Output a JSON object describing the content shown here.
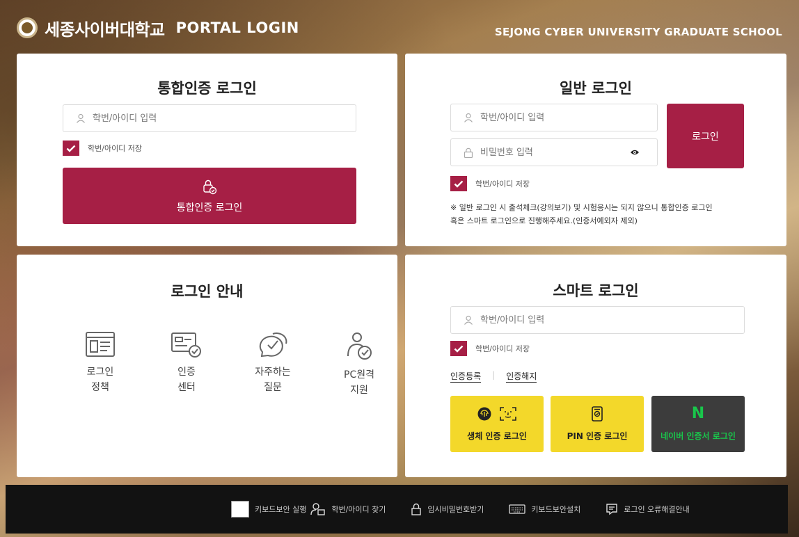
{
  "header": {
    "brand_name": "세종사이버대학교",
    "brand_sub": "PORTAL LOGIN",
    "graduate": "SEJONG CYBER UNIVERSITY GRADUATE SCHOOL"
  },
  "integrated": {
    "title": "통합인증 로그인",
    "id_placeholder": "학번/아이디 입력",
    "save_id_label": "학번/아이디 저장",
    "login_button": "통합인증 로그인"
  },
  "general": {
    "title": "일반 로그인",
    "id_placeholder": "학번/아이디 입력",
    "pw_placeholder": "비밀번호 입력",
    "login_button": "로그인",
    "save_id_label": "학번/아이디 저장",
    "notice_line1": "※ 일반 로그인 시 출석체크(강의보기) 및 시험응시는 되지 않으니 통합인증 로그인",
    "notice_line2": "혹은 스마트 로그인으로 진행해주세요.(인증서예외자 제외)"
  },
  "guide": {
    "title": "로그인 안내",
    "items": [
      {
        "line1": "로그인",
        "line2": "정책",
        "icon": "policy-document-icon"
      },
      {
        "line1": "인증",
        "line2": "센터",
        "icon": "certificate-card-icon"
      },
      {
        "line1": "자주하는",
        "line2": "질문",
        "icon": "faq-chat-icon"
      },
      {
        "line1": "PC원격",
        "line2": "지원",
        "icon": "remote-support-user-icon"
      }
    ]
  },
  "smart": {
    "title": "스마트 로그인",
    "id_placeholder": "학번/아이디 입력",
    "save_id_label": "학번/아이디 저장",
    "cert_register": "인증등록",
    "cert_cancel": "인증해지",
    "bio_login": "생체 인증 로그인",
    "pin_login": "PIN 인증 로그인",
    "naver_login": "네이버 인증서 로그인",
    "naver_letter": "N",
    "yellow": "#f3d82a",
    "dark": "#3c3c3c",
    "naver_green": "#19c64b"
  },
  "footer": {
    "keyboard_security_run": "키보드보안 실행",
    "find_id": "학번/아이디 찾기",
    "temp_password": "임시비밀번호받기",
    "install_keyboard_security": "키보드보안설치",
    "login_error_guide": "로그인 오류해결안내"
  },
  "colors": {
    "accent": "#a61f45"
  }
}
